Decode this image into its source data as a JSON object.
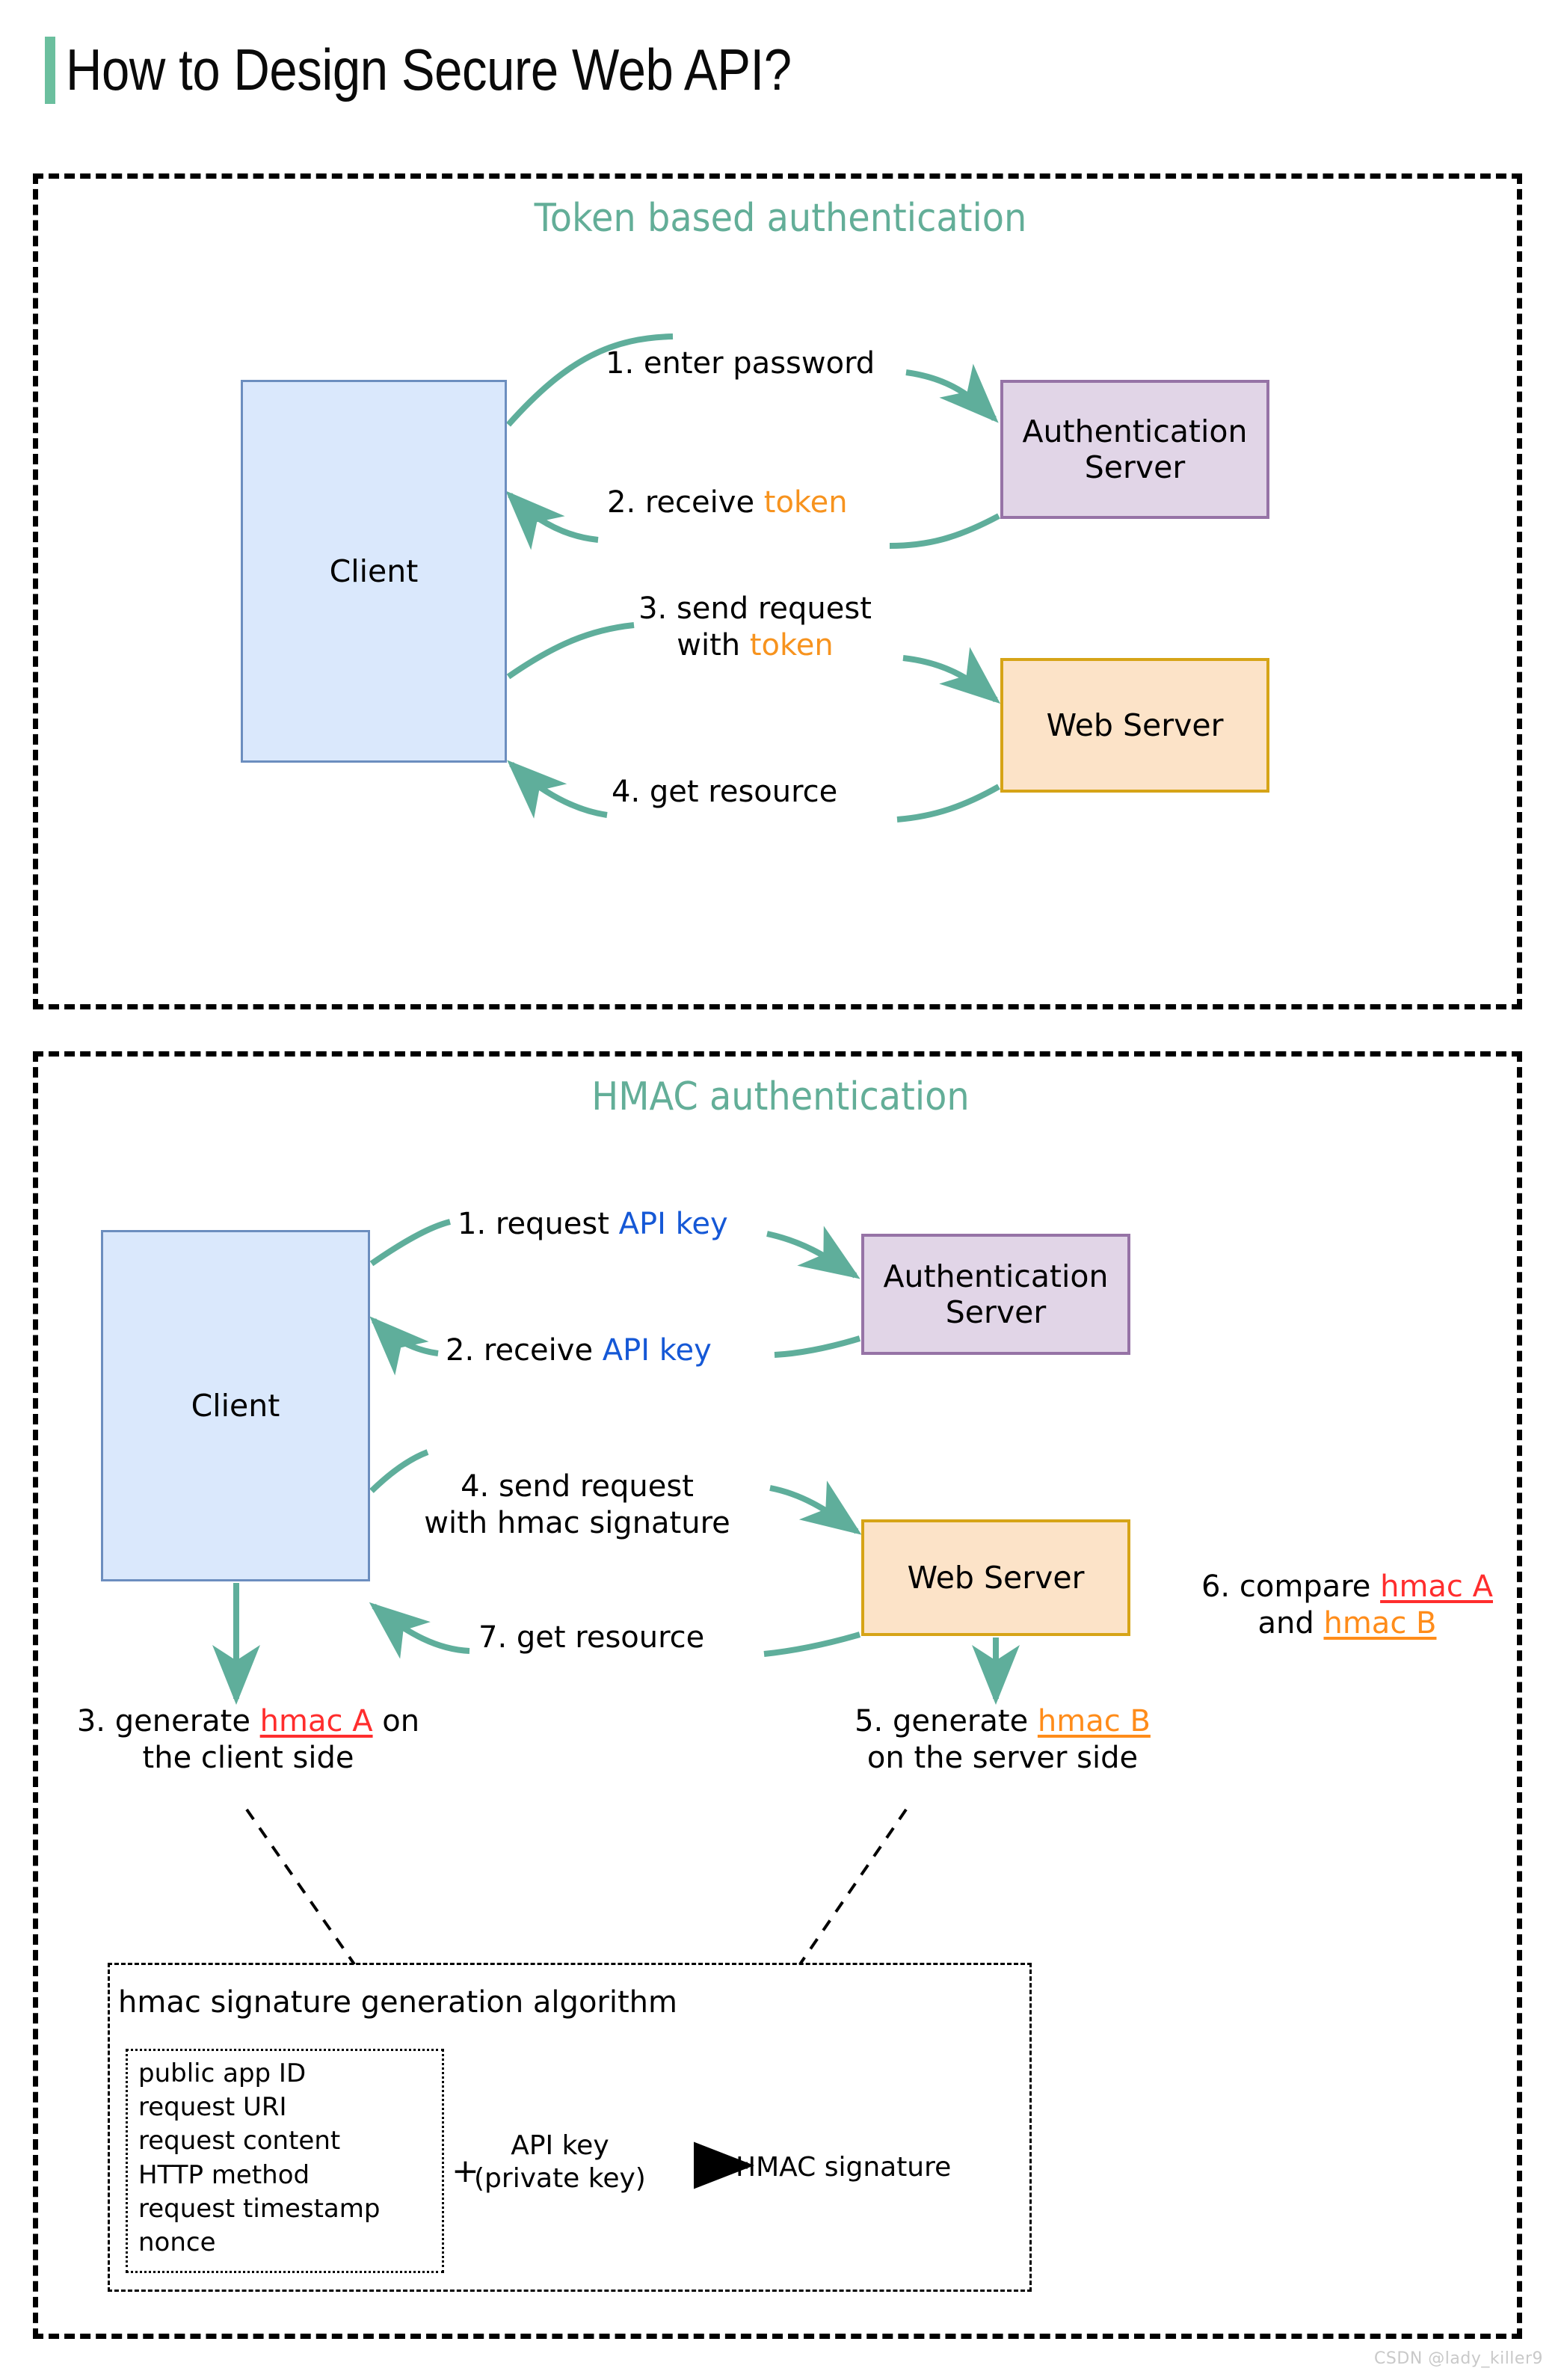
{
  "page": {
    "title": "How to Design Secure Web API?",
    "accent_color": "#6BBF9E",
    "watermark": "CSDN @lady_killer9"
  },
  "colors": {
    "arrow": "#5FAE9B",
    "heading": "#63AE98",
    "client_fill": "#DAE8FC",
    "client_stroke": "#6C8EBF",
    "auth_fill": "#E1D5E7",
    "auth_stroke": "#9673A6",
    "web_fill": "#FCE3C8",
    "web_stroke": "#D6A417",
    "token_keyword": "#F7931E",
    "apikey_keyword": "#1558D6",
    "hmac_a_keyword": "#FF2D2D",
    "hmac_b_keyword": "#FF8C1A"
  },
  "sections": {
    "token": {
      "heading": "Token based authentication",
      "nodes": {
        "client": "Client",
        "auth_server": "Authentication\nServer",
        "web_server": "Web Server"
      },
      "flows": [
        {
          "id": "1",
          "prefix": "1. enter password",
          "keyword": "",
          "suffix": ""
        },
        {
          "id": "2",
          "prefix": "2. receive ",
          "keyword": "token",
          "suffix": ""
        },
        {
          "id": "3",
          "prefix": "3.  send request",
          "line2_prefix": "with ",
          "keyword": "token",
          "suffix": ""
        },
        {
          "id": "4",
          "prefix": "4. get resource",
          "keyword": "",
          "suffix": ""
        }
      ]
    },
    "hmac": {
      "heading": "HMAC authentication",
      "nodes": {
        "client": "Client",
        "auth_server": "Authentication\nServer",
        "web_server": "Web Server"
      },
      "flows": [
        {
          "id": "1",
          "prefix": "1. request ",
          "keyword": "API key",
          "suffix": ""
        },
        {
          "id": "2",
          "prefix": "2. receive ",
          "keyword": "API key",
          "suffix": ""
        },
        {
          "id": "4",
          "line1": "4. send request",
          "line2": "with hmac signature"
        },
        {
          "id": "7",
          "prefix": "7. get resource",
          "keyword": "",
          "suffix": ""
        },
        {
          "id": "6",
          "line1_prefix": "6. compare ",
          "keyword_a": "hmac A",
          "line2_prefix": "and ",
          "keyword_b": "hmac B"
        },
        {
          "id": "3",
          "line1_prefix": "3. generate ",
          "keyword_a": "hmac A",
          "line1_suffix": " on",
          "line2": "the client side"
        },
        {
          "id": "5",
          "line1_prefix": "5. generate ",
          "keyword_b": "hmac B",
          "line2": "on the server side"
        }
      ],
      "algorithm": {
        "title": "hmac signature generation algorithm",
        "inputs": [
          "public app ID",
          "request URI",
          "request content",
          "HTTP method",
          "request timestamp",
          "nonce"
        ],
        "plus": "+",
        "key_line1": "API key",
        "key_line2": "(private key)",
        "result": "HMAC signature"
      }
    }
  }
}
